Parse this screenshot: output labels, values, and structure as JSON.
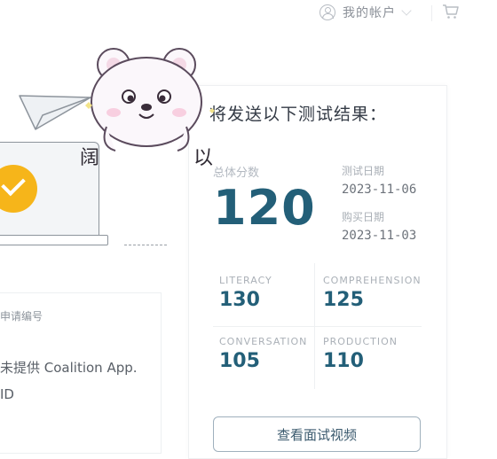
{
  "header": {
    "account_label": "我的帐户"
  },
  "left_card": {
    "application_label": "申请编号",
    "application_value_line1": "未提供 Coalition App.",
    "application_value_line2": "ID"
  },
  "results": {
    "heading": "将发送以下测试结果：",
    "overall_label": "总体分数",
    "overall_score": "120",
    "test_date_label": "测试日期",
    "test_date_value": "2023-11-06",
    "purchase_date_label": "购买日期",
    "purchase_date_value": "2023-11-03",
    "subscores": [
      {
        "label": "LITERACY",
        "value": "130"
      },
      {
        "label": "COMPREHENSION",
        "value": "125"
      },
      {
        "label": "CONVERSATION",
        "value": "105"
      },
      {
        "label": "PRODUCTION",
        "value": "110"
      }
    ],
    "video_button_label": "查看面试视频"
  },
  "sticker": {
    "left_char": "阔",
    "right_char": "以"
  },
  "colors": {
    "score_blue": "#235f78",
    "check_yellow": "#f6b51a"
  }
}
